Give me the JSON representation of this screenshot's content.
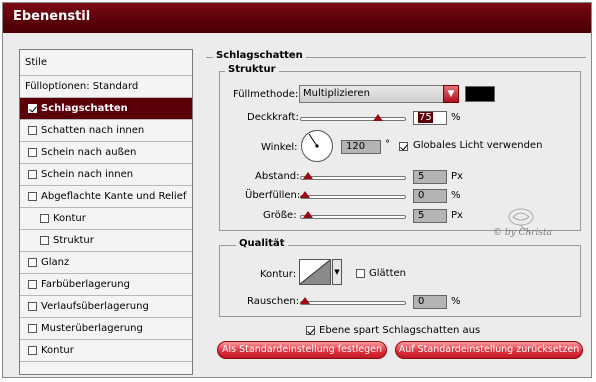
{
  "window": {
    "title": "Ebenenstil"
  },
  "sidebar": {
    "header": "Stile",
    "items": [
      {
        "label": "Fülloptionen: Standard",
        "checkbox": false
      },
      {
        "label": "Schlagschatten",
        "checkbox": true,
        "checked": true,
        "selected": true
      },
      {
        "label": "Schatten nach innen",
        "checkbox": true,
        "checked": false
      },
      {
        "label": "Schein nach außen",
        "checkbox": true,
        "checked": false
      },
      {
        "label": "Schein nach innen",
        "checkbox": true,
        "checked": false
      },
      {
        "label": "Abgeflachte Kante und Relief",
        "checkbox": true,
        "checked": false
      },
      {
        "label": "Kontur",
        "checkbox": true,
        "checked": false,
        "indent": true
      },
      {
        "label": "Struktur",
        "checkbox": true,
        "checked": false,
        "indent": true
      },
      {
        "label": "Glanz",
        "checkbox": true,
        "checked": false
      },
      {
        "label": "Farbüberlagerung",
        "checkbox": true,
        "checked": false
      },
      {
        "label": "Verlaufsüberlagerung",
        "checkbox": true,
        "checked": false
      },
      {
        "label": "Musterüberlagerung",
        "checkbox": true,
        "checked": false
      },
      {
        "label": "Kontur",
        "checkbox": true,
        "checked": false
      }
    ]
  },
  "panel": {
    "section_title": "Schlagschatten",
    "struktur": {
      "title": "Struktur",
      "fuellmethode_label": "Füllmethode:",
      "fuellmethode_value": "Multiplizieren",
      "deckkraft_label": "Deckkraft:",
      "deckkraft_value": "75",
      "deckkraft_unit": "%",
      "deckkraft_level": 0.75,
      "winkel_label": "Winkel:",
      "winkel_value": "120",
      "winkel_unit": "°",
      "globales_licht_label": "Globales Licht verwenden",
      "globales_licht_checked": true,
      "abstand_label": "Abstand:",
      "abstand_value": "5",
      "abstand_unit": "Px",
      "ueberfuellen_label": "Überfüllen:",
      "ueberfuellen_value": "0",
      "ueberfuellen_unit": "%",
      "groesse_label": "Größe:",
      "groesse_value": "5",
      "groesse_unit": "Px"
    },
    "qualitaet": {
      "title": "Qualität",
      "kontur_label": "Kontur:",
      "glaetten_label": "Glätten",
      "glaetten_checked": false,
      "rauschen_label": "Rauschen:",
      "rauschen_value": "0",
      "rauschen_unit": "%"
    },
    "ebene_spart_label": "Ebene spart Schlagschatten aus",
    "ebene_spart_checked": true,
    "btn_default_set": "Als Standardeinstellung festlegen",
    "btn_default_reset": "Auf Standardeinstellung zurücksetzen"
  },
  "watermark": {
    "text": "© by Christa"
  },
  "colors": {
    "accent": "#5a0008",
    "button": "#e0303c",
    "shadow_color": "#000000"
  }
}
